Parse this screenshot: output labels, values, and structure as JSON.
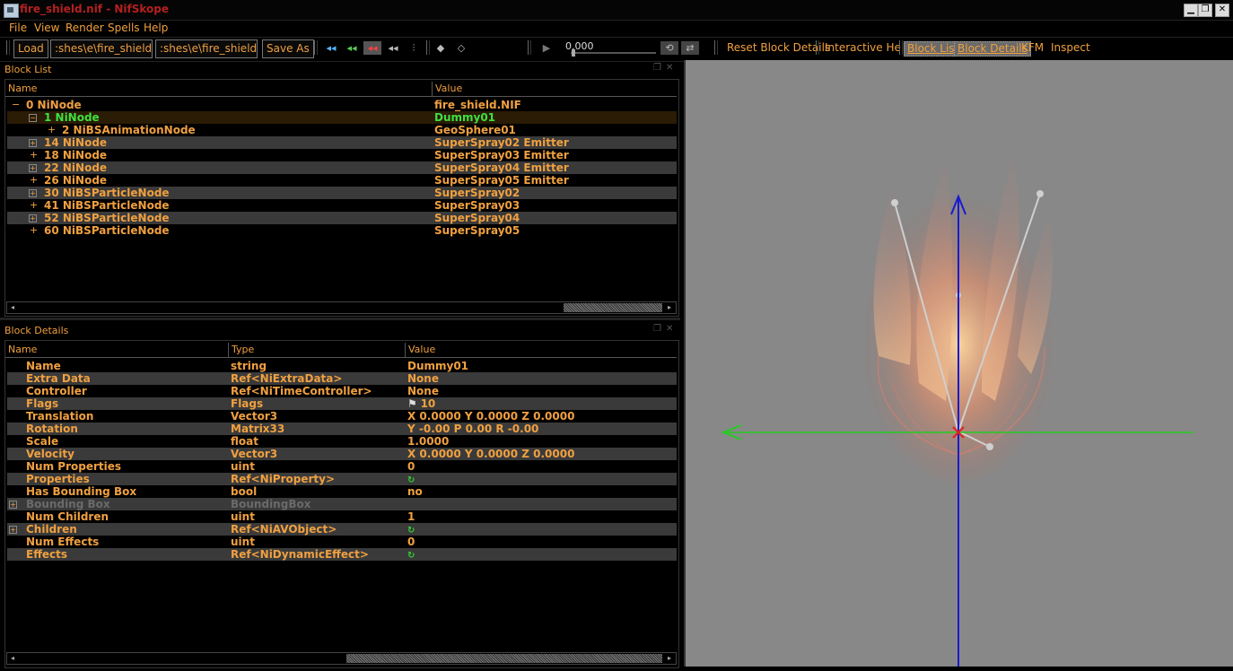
{
  "window": {
    "title": "fire_shield.nif - NifSkope",
    "minimize_glyph": "▁",
    "restore_glyph": "❐",
    "close_glyph": "✕"
  },
  "menu": {
    "file": "File",
    "view": "View",
    "render": "Render",
    "spells": "Spells",
    "help": "Help"
  },
  "toolbar": {
    "load": "Load",
    "load_path": ":shes\\e\\fire_shield.nif",
    "save_path": ":shes\\e\\fire_shield.nif",
    "save_as": "Save As",
    "time_value": "0.000",
    "reset_block_details": "Reset Block Details",
    "interactive_help": "Interactive Help",
    "block_list": "Block List",
    "block_details": "Block Details",
    "kfm": "KFM",
    "inspect": "Inspect"
  },
  "block_list": {
    "title": "Block List",
    "col_name": "Name",
    "col_value": "Value",
    "rows": [
      {
        "name": "0 NiNode",
        "value": "fire_shield.NIF"
      },
      {
        "name": "1 NiNode",
        "value": "Dummy01"
      },
      {
        "name": "2 NiBSAnimationNode",
        "value": "GeoSphere01"
      },
      {
        "name": "14 NiNode",
        "value": "SuperSpray02 Emitter"
      },
      {
        "name": "18 NiNode",
        "value": "SuperSpray03 Emitter"
      },
      {
        "name": "22 NiNode",
        "value": "SuperSpray04 Emitter"
      },
      {
        "name": "26 NiNode",
        "value": "SuperSpray05 Emitter"
      },
      {
        "name": "30 NiBSParticleNode",
        "value": "SuperSpray02"
      },
      {
        "name": "41 NiBSParticleNode",
        "value": "SuperSpray03"
      },
      {
        "name": "52 NiBSParticleNode",
        "value": "SuperSpray04"
      },
      {
        "name": "60 NiBSParticleNode",
        "value": "SuperSpray05"
      }
    ]
  },
  "block_details": {
    "title": "Block Details",
    "col_name": "Name",
    "col_type": "Type",
    "col_value": "Value",
    "rows": [
      {
        "name": "Name",
        "type": "string",
        "value": "Dummy01"
      },
      {
        "name": "Extra Data",
        "type": "Ref<NiExtraData>",
        "value": "None"
      },
      {
        "name": "Controller",
        "type": "Ref<NiTimeController>",
        "value": "None"
      },
      {
        "name": "Flags",
        "type": "Flags",
        "value": "10"
      },
      {
        "name": "Translation",
        "type": "Vector3",
        "value": "X 0.0000 Y 0.0000 Z 0.0000"
      },
      {
        "name": "Rotation",
        "type": "Matrix33",
        "value": "Y -0.00 P 0.00 R -0.00"
      },
      {
        "name": "Scale",
        "type": "float",
        "value": "1.0000"
      },
      {
        "name": "Velocity",
        "type": "Vector3",
        "value": "X 0.0000 Y 0.0000 Z 0.0000"
      },
      {
        "name": "Num Properties",
        "type": "uint",
        "value": "0"
      },
      {
        "name": "Properties",
        "type": "Ref<NiProperty>",
        "value": ""
      },
      {
        "name": "Has Bounding Box",
        "type": "bool",
        "value": "no"
      },
      {
        "name": "Bounding Box",
        "type": "BoundingBox",
        "value": ""
      },
      {
        "name": "Num Children",
        "type": "uint",
        "value": "1"
      },
      {
        "name": "Children",
        "type": "Ref<NiAVObject>",
        "value": ""
      },
      {
        "name": "Num Effects",
        "type": "uint",
        "value": "0"
      },
      {
        "name": "Effects",
        "type": "Ref<NiDynamicEffect>",
        "value": ""
      }
    ]
  },
  "colors": {
    "text": "#f0a040",
    "title": "#b42020",
    "selected_node": "#40e040",
    "disabled": "#6a6a6a",
    "viewport_bg": "#888888",
    "axis_green": "#22cc22",
    "axis_blue": "#1a1ad0"
  }
}
